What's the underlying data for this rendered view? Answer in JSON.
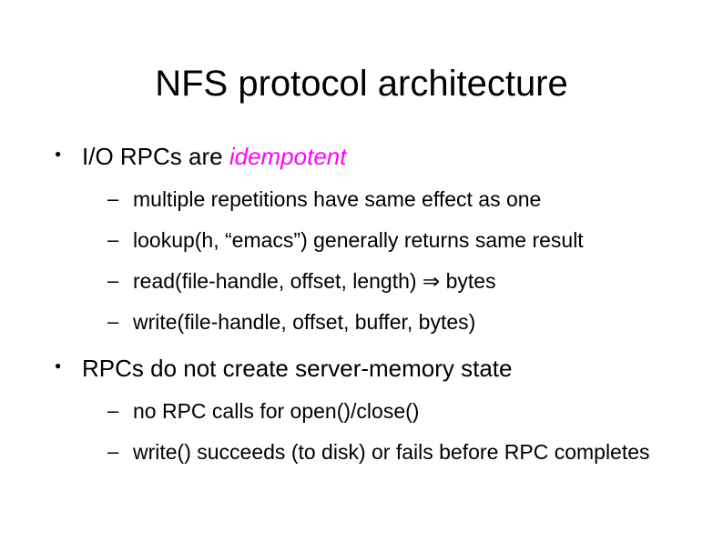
{
  "title": "NFS protocol architecture",
  "bullets": [
    {
      "text_before": "I/O RPCs are ",
      "emph": "idempotent",
      "text_after": "",
      "sub": [
        "multiple repetitions have same effect as one",
        "lookup(h, “emacs”) generally returns same result",
        "read(file-handle, offset, length) ⇒ bytes",
        "write(file-handle, offset, buffer, bytes)"
      ]
    },
    {
      "text_before": "RPCs do not create server-memory state",
      "emph": "",
      "text_after": "",
      "sub": [
        "no RPC calls for open()/close()",
        "write() succeeds (to disk) or fails before RPC completes"
      ]
    }
  ]
}
